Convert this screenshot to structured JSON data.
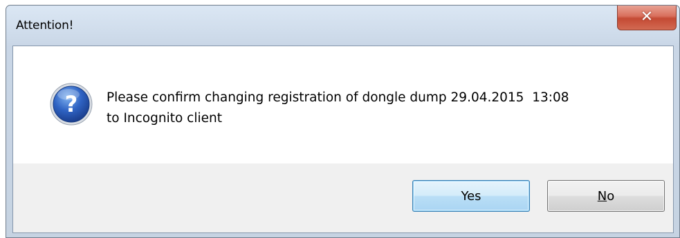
{
  "window": {
    "title": "Attention!",
    "close_icon": "close-icon"
  },
  "dialog": {
    "icon": "question-icon",
    "message_line1": "Please confirm changing registration of dongle dump 29.04.2015  13:08",
    "message_line2": "to Incognito client"
  },
  "buttons": {
    "yes_label": "Yes",
    "no_label_accel": "N",
    "no_label_rest": "o"
  },
  "colors": {
    "title_bar": "#cfdceb",
    "close_button": "#c44a34",
    "default_button_border": "#3c7fb1"
  }
}
